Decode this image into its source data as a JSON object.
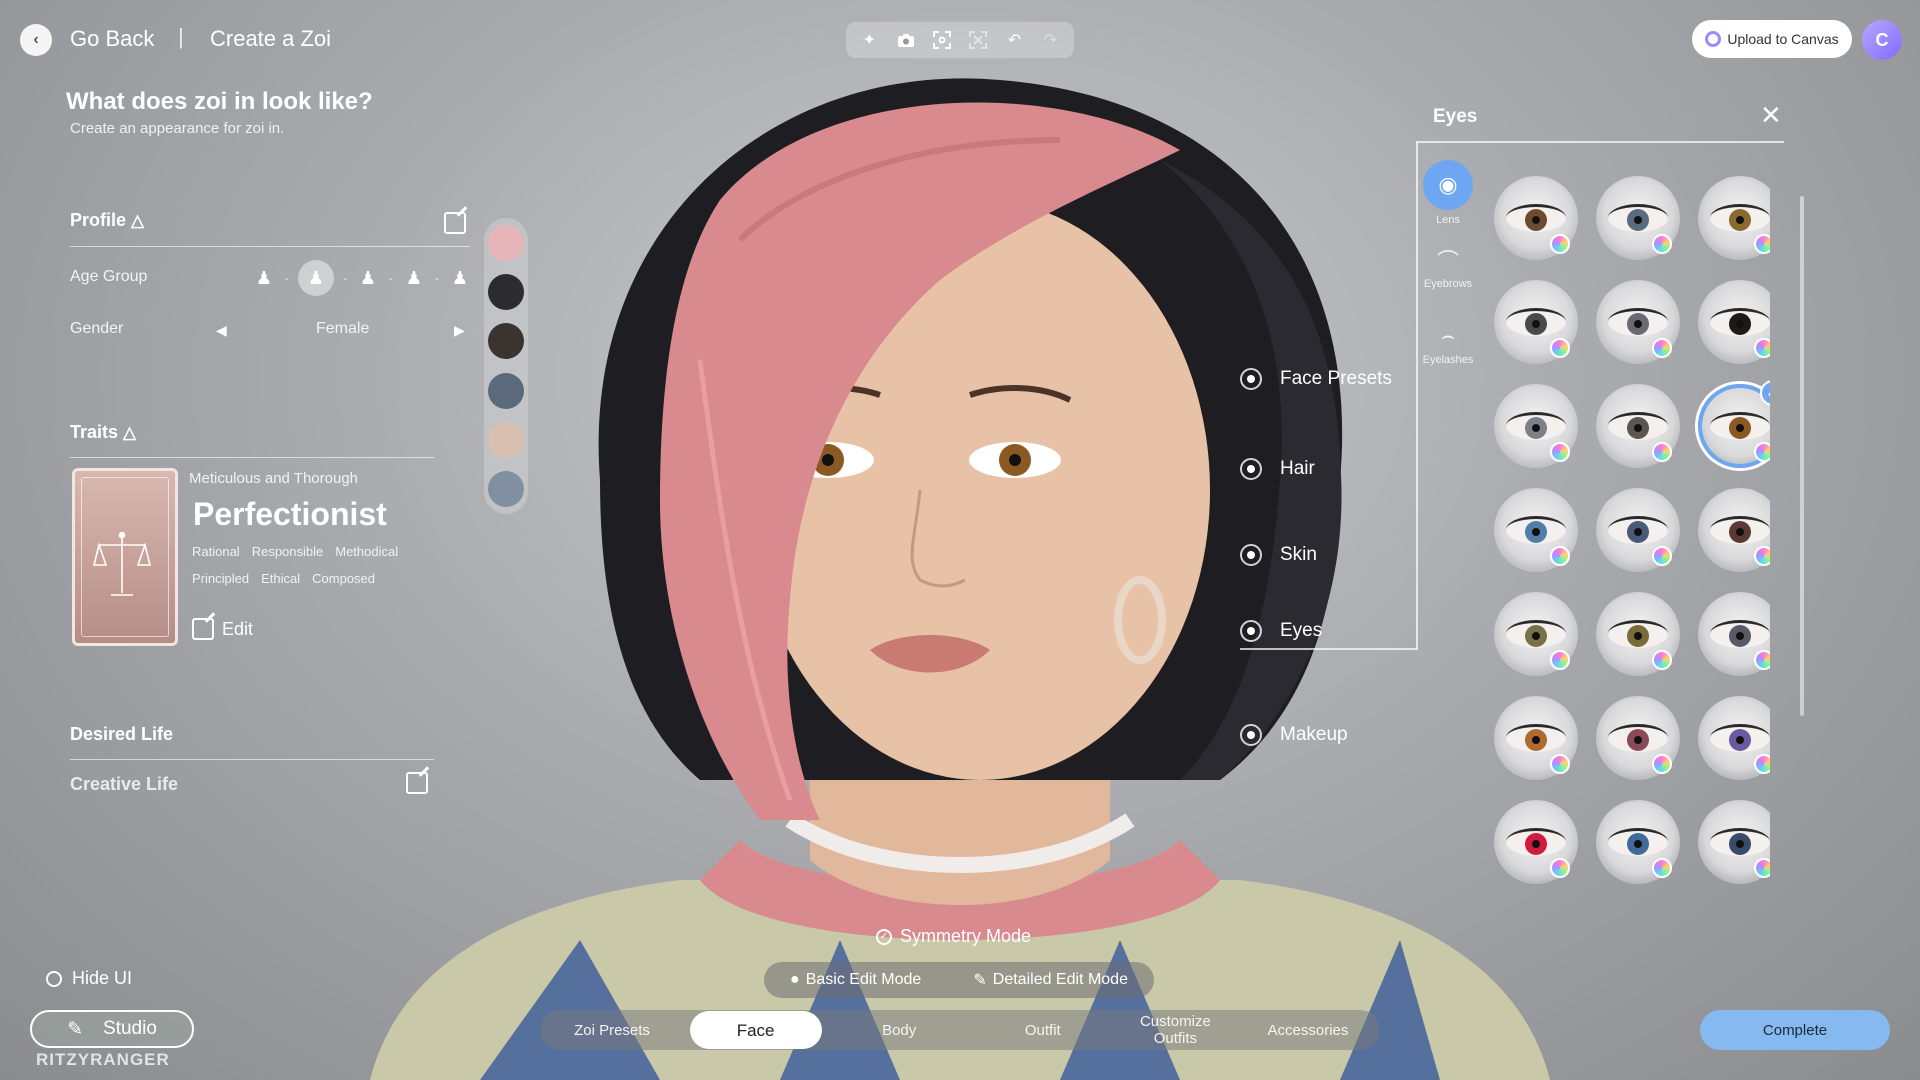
{
  "header": {
    "back_label": "Go Back",
    "separator": "|",
    "title": "Create a Zoi",
    "upload_label": "Upload to Canvas",
    "avatar_letter": "C"
  },
  "toolbar": {
    "icons": [
      "sparkle-icon",
      "camera-icon",
      "frame-icon",
      "grid-icon",
      "undo-icon",
      "redo-icon"
    ]
  },
  "page": {
    "heading": "What does zoi in look like?",
    "subheading": "Create an appearance for zoi in."
  },
  "profile": {
    "title": "Profile",
    "age_label": "Age Group",
    "age_selected_index": 1,
    "gender_label": "Gender",
    "gender_value": "Female"
  },
  "traits": {
    "title": "Traits",
    "category": "Meticulous and Thorough",
    "name": "Perfectionist",
    "tags_row1": [
      "Rational",
      "Responsible",
      "Methodical"
    ],
    "tags_row2": [
      "Principled",
      "Ethical",
      "Composed"
    ],
    "edit_label": "Edit"
  },
  "desired_life": {
    "title": "Desired Life",
    "value": "Creative Life"
  },
  "face_menu": {
    "items": [
      "Face Presets",
      "Hair",
      "Skin",
      "Eyes",
      "Makeup"
    ],
    "active": "Eyes"
  },
  "eyes_panel": {
    "title": "Eyes",
    "tabs": [
      {
        "label": "Lens",
        "active": true
      },
      {
        "label": "Eyebrows",
        "active": false
      },
      {
        "label": "Eyelashes",
        "active": false
      }
    ],
    "swatches": [
      "#6b4a2e",
      "#5a6a80",
      "#8a6a2e",
      "#4a4a4a",
      "#6a6a72",
      "#1e1a18",
      "#7a8288",
      "#5c5650",
      "#8a5a22",
      "#4f7fa8",
      "#4a5a7a",
      "#5a3a32",
      "#7a7048",
      "#7a6a3a",
      "#585a68",
      "#b06a30",
      "#8a4a5a",
      "#6a5aa0",
      "#d01a40",
      "#3f6a9a",
      "#3a4a6a"
    ],
    "selected_index": 8
  },
  "bottom": {
    "symmetry_label": "Symmetry Mode",
    "basic_label": "Basic Edit Mode",
    "detailed_label": "Detailed Edit Mode",
    "tabs": [
      "Zoi Presets",
      "Face",
      "Body",
      "Outfit",
      "Customize Outfits",
      "Accessories"
    ],
    "active_tab": "Face",
    "complete_label": "Complete",
    "hide_ui_label": "Hide UI",
    "studio_label": "Studio",
    "watermark": "RITZYRANGER"
  },
  "colors": {
    "accent": "#6ea6f2",
    "hair_pink": "#d98a8e",
    "hair_dark": "#1e1e22",
    "skin": "#e8c2a6"
  }
}
